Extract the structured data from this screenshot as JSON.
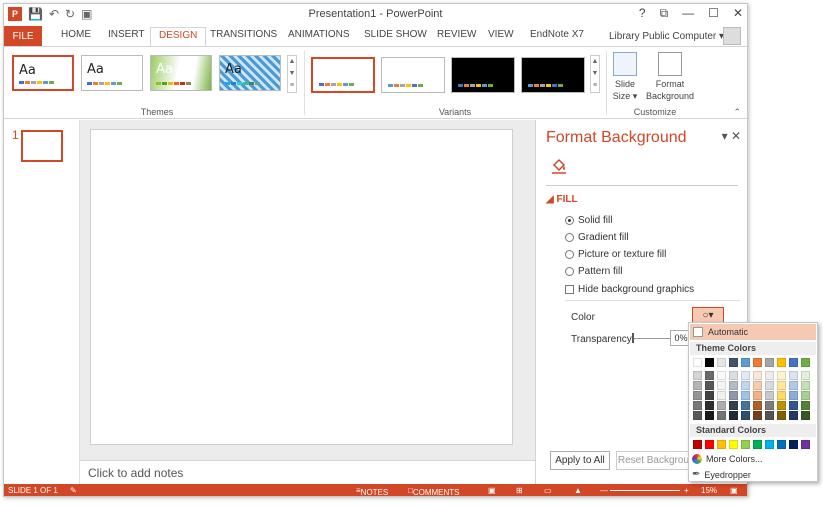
{
  "window": {
    "title": "Presentation1 - PowerPoint"
  },
  "titlebar_controls": [
    "?",
    "⧉",
    "—",
    "☐",
    "✕"
  ],
  "tabs": [
    {
      "label": "FILE"
    },
    {
      "label": "HOME"
    },
    {
      "label": "INSERT"
    },
    {
      "label": "DESIGN"
    },
    {
      "label": "TRANSITIONS"
    },
    {
      "label": "ANIMATIONS"
    },
    {
      "label": "SLIDE SHOW"
    },
    {
      "label": "REVIEW"
    },
    {
      "label": "VIEW"
    },
    {
      "label": "EndNote X7"
    }
  ],
  "active_tab": "DESIGN",
  "user": {
    "name": "Library Public Computer ▾"
  },
  "ribbon": {
    "themes_label": "Themes",
    "variants_label": "Variants",
    "customize_label": "Customize",
    "theme_sample": "Aa",
    "slide_size": "Slide\nSize ▾",
    "format_background": "Format\nBackground"
  },
  "slide_panel": {
    "number": "1"
  },
  "notes": {
    "placeholder": "Click to add notes"
  },
  "pane": {
    "title": "Format Background",
    "section": "FILL",
    "options": [
      {
        "label": "Solid fill",
        "type": "radio",
        "selected": true
      },
      {
        "label": "Gradient fill",
        "type": "radio",
        "selected": false
      },
      {
        "label": "Picture or texture fill",
        "type": "radio",
        "selected": false
      },
      {
        "label": "Pattern fill",
        "type": "radio",
        "selected": false
      },
      {
        "label": "Hide background graphics",
        "type": "checkbox",
        "selected": false
      }
    ],
    "color_label": "Color",
    "transparency_label": "Transparency",
    "transparency_value": "0%",
    "apply_all": "Apply to All",
    "reset_bg": "Reset Background"
  },
  "color_dropdown": {
    "automatic": "Automatic",
    "theme_colors_label": "Theme Colors",
    "standard_colors_label": "Standard Colors",
    "more_colors": "More Colors...",
    "eyedropper": "Eyedropper",
    "theme_row": [
      "#ffffff",
      "#000000",
      "#e7e6e6",
      "#44546a",
      "#5b9bd5",
      "#ed7d31",
      "#a5a5a5",
      "#ffc000",
      "#4472c4",
      "#70ad47"
    ],
    "standard_row": [
      "#c00000",
      "#ff0000",
      "#ffc000",
      "#ffff00",
      "#92d050",
      "#00b050",
      "#00b0f0",
      "#0070c0",
      "#002060",
      "#7030a0"
    ]
  },
  "status": {
    "slide": "SLIDE 1 OF 1",
    "notes": "NOTES",
    "comments": "COMMENTS",
    "zoom": "15%"
  },
  "colors": {
    "accent": "#d24726"
  }
}
